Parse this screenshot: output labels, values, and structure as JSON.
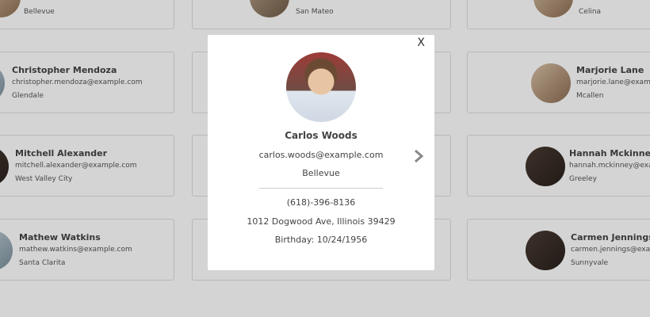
{
  "cards": [
    {
      "name": "",
      "email": "",
      "city": "Bellevue"
    },
    {
      "name": "",
      "email": "",
      "city": "San Mateo"
    },
    {
      "name": "",
      "email": "",
      "city": "Celina"
    },
    {
      "name": "Christopher Mendoza",
      "email": "christopher.mendoza@example.com",
      "city": "Glendale"
    },
    {
      "name": "Marjorie Lane",
      "email": "marjorie.lane@example.com",
      "city": "Mcallen"
    },
    {
      "name": "Mitchell Alexander",
      "email": "mitchell.alexander@example.com",
      "city": "West Valley City"
    },
    {
      "name": "Hannah Mckinney",
      "email": "hannah.mckinney@example.com",
      "city": "Greeley"
    },
    {
      "name": "Mathew Watkins",
      "email": "mathew.watkins@example.com",
      "city": "Santa Clarita"
    },
    {
      "name": "Carmen Jennings",
      "email": "carmen.jennings@example.com",
      "city": "Sunnyvale"
    }
  ],
  "modal": {
    "close_label": "X",
    "name": "Carlos Woods",
    "email": "carlos.woods@example.com",
    "city": "Bellevue",
    "phone": "(618)-396-8136",
    "address": "1012 Dogwood Ave, Illinois 39429",
    "birthday": "Birthday: 10/24/1956",
    "next_icon": "chevron-right-icon"
  }
}
